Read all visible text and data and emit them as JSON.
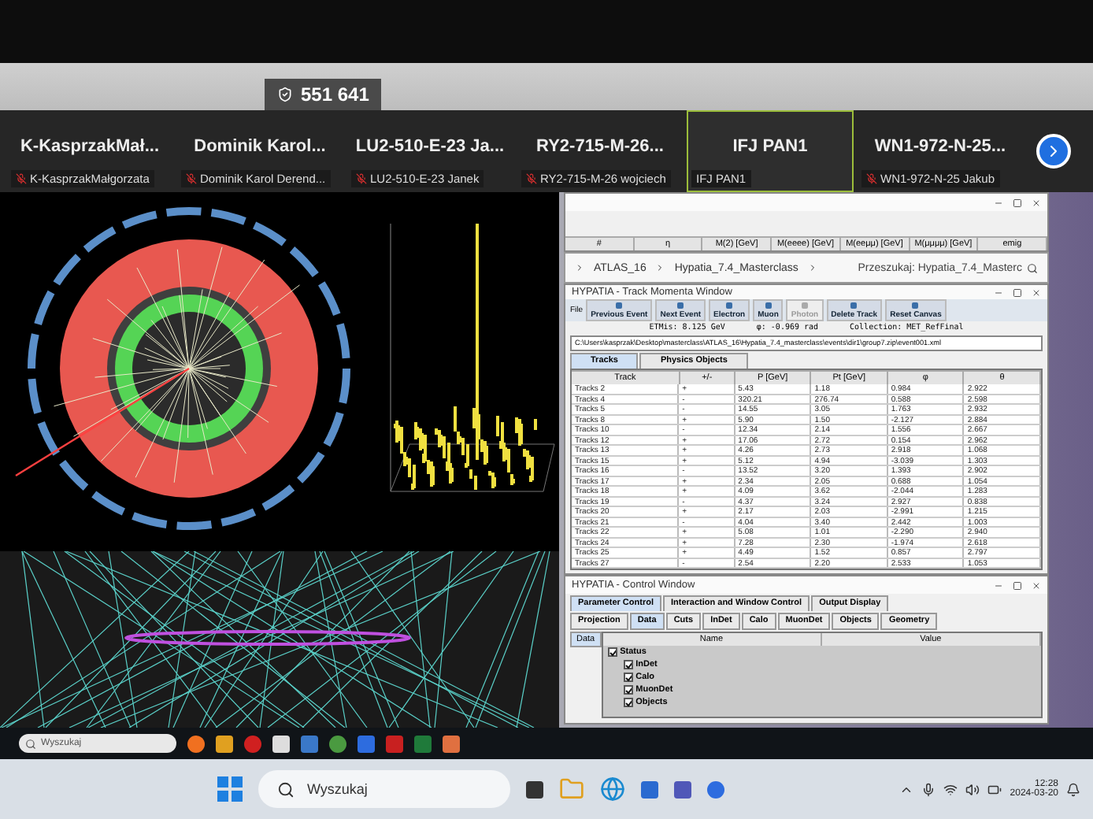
{
  "meeting": {
    "id": "551 641"
  },
  "participants": [
    {
      "name": "K-KasprzakMał...",
      "label": "K-KasprzakMałgorzata",
      "muted": true,
      "active": false
    },
    {
      "name": "Dominik Karol...",
      "label": "Dominik Karol Derend...",
      "muted": true,
      "active": false
    },
    {
      "name": "LU2-510-E-23 Ja...",
      "label": "LU2-510-E-23 Janek",
      "muted": true,
      "active": false
    },
    {
      "name": "RY2-715-M-26...",
      "label": "RY2-715-M-26 wojciech",
      "muted": true,
      "active": false
    },
    {
      "name": "IFJ PAN1",
      "label": "IFJ PAN1",
      "muted": false,
      "active": true
    },
    {
      "name": "WN1-972-N-25...",
      "label": "WN1-972-N-25 Jakub",
      "muted": true,
      "active": false
    }
  ],
  "invariant_mass_window": {
    "columns": [
      "#",
      "η",
      "M(2) [GeV]",
      "M(eeee) [GeV]",
      "M(eeμμ) [GeV]",
      "M(μμμμ) [GeV]",
      "emig"
    ]
  },
  "explorer": {
    "breadcrumb": [
      "ATLAS_16",
      "Hypatia_7.4_Masterclass"
    ],
    "search_placeholder": "Przeszukaj: Hypatia_7.4_Masterc"
  },
  "track_window": {
    "title": "HYPATIA - Track Momenta Window",
    "menu": "File",
    "toolbar": [
      {
        "label": "Previous Event",
        "disabled": false
      },
      {
        "label": "Next Event",
        "disabled": false
      },
      {
        "label": "Electron",
        "disabled": false
      },
      {
        "label": "Muon",
        "disabled": false
      },
      {
        "label": "Photon",
        "disabled": true
      },
      {
        "label": "Delete Track",
        "disabled": false
      },
      {
        "label": "Reset Canvas",
        "disabled": false
      }
    ],
    "info": [
      "ETMis: 8.125 GeV",
      "φ: -0.969 rad",
      "Collection: MET_RefFinal"
    ],
    "path": "C:\\Users\\kasprzak\\Desktop\\masterclass\\ATLAS_16\\Hypatia_7.4_masterclass\\events\\dir1\\group7.zip\\event001.xml",
    "tabs": [
      {
        "label": "Tracks",
        "selected": true
      },
      {
        "label": "Physics Objects",
        "selected": false
      }
    ],
    "columns": [
      "Track",
      "+/-",
      "P [GeV]",
      "Pt [GeV]",
      "φ",
      "θ"
    ],
    "rows": [
      [
        "Tracks 2",
        "+",
        "5.43",
        "1.18",
        "0.984",
        "2.922"
      ],
      [
        "Tracks 4",
        "-",
        "320.21",
        "276.74",
        "0.588",
        "2.598"
      ],
      [
        "Tracks 5",
        "-",
        "14.55",
        "3.05",
        "1.763",
        "2.932"
      ],
      [
        "Tracks 8",
        "+",
        "5.90",
        "1.50",
        "-2.127",
        "2.884"
      ],
      [
        "Tracks 10",
        "-",
        "12.34",
        "2.14",
        "1.556",
        "2.667"
      ],
      [
        "Tracks 12",
        "+",
        "17.06",
        "2.72",
        "0.154",
        "2.962"
      ],
      [
        "Tracks 13",
        "+",
        "4.26",
        "2.73",
        "2.918",
        "1.068"
      ],
      [
        "Tracks 15",
        "+",
        "5.12",
        "4.94",
        "-3.039",
        "1.303"
      ],
      [
        "Tracks 16",
        "-",
        "13.52",
        "3.20",
        "1.393",
        "2.902"
      ],
      [
        "Tracks 17",
        "+",
        "2.34",
        "2.05",
        "0.688",
        "1.054"
      ],
      [
        "Tracks 18",
        "+",
        "4.09",
        "3.62",
        "-2.044",
        "1.283"
      ],
      [
        "Tracks 19",
        "-",
        "4.37",
        "3.24",
        "2.927",
        "0.838"
      ],
      [
        "Tracks 20",
        "+",
        "2.17",
        "2.03",
        "-2.991",
        "1.215"
      ],
      [
        "Tracks 21",
        "-",
        "4.04",
        "3.40",
        "2.442",
        "1.003"
      ],
      [
        "Tracks 22",
        "+",
        "5.08",
        "1.01",
        "-2.290",
        "2.940"
      ],
      [
        "Tracks 24",
        "+",
        "7.28",
        "2.30",
        "-1.974",
        "2.618"
      ],
      [
        "Tracks 25",
        "+",
        "4.49",
        "1.52",
        "0.857",
        "2.797"
      ],
      [
        "Tracks 27",
        "-",
        "2.54",
        "2.20",
        "2.533",
        "1.053"
      ]
    ]
  },
  "control_window": {
    "title": "HYPATIA - Control Window",
    "tabs": [
      {
        "label": "Parameter Control",
        "selected": true
      },
      {
        "label": "Interaction and Window Control",
        "selected": false
      },
      {
        "label": "Output Display",
        "selected": false
      }
    ],
    "subtabs": [
      {
        "label": "Projection",
        "selected": false
      },
      {
        "label": "Data",
        "selected": true
      },
      {
        "label": "Cuts",
        "selected": false
      },
      {
        "label": "InDet",
        "selected": false
      },
      {
        "label": "Calo",
        "selected": false
      },
      {
        "label": "MuonDet",
        "selected": false
      },
      {
        "label": "Objects",
        "selected": false
      },
      {
        "label": "Geometry",
        "selected": false
      }
    ],
    "side_tab": "Data",
    "columns": [
      "Name",
      "Value"
    ],
    "tree": [
      {
        "label": "Status",
        "checked": true,
        "children": [
          {
            "label": "InDet",
            "checked": true
          },
          {
            "label": "Calo",
            "checked": true
          },
          {
            "label": "MuonDet",
            "checked": true
          },
          {
            "label": "Objects",
            "checked": true
          }
        ]
      }
    ]
  },
  "inner_taskbar": {
    "search_placeholder": "Wyszukaj"
  },
  "taskbar": {
    "search_placeholder": "Wyszukaj",
    "time": "12:28",
    "date": "2024-03-20"
  }
}
